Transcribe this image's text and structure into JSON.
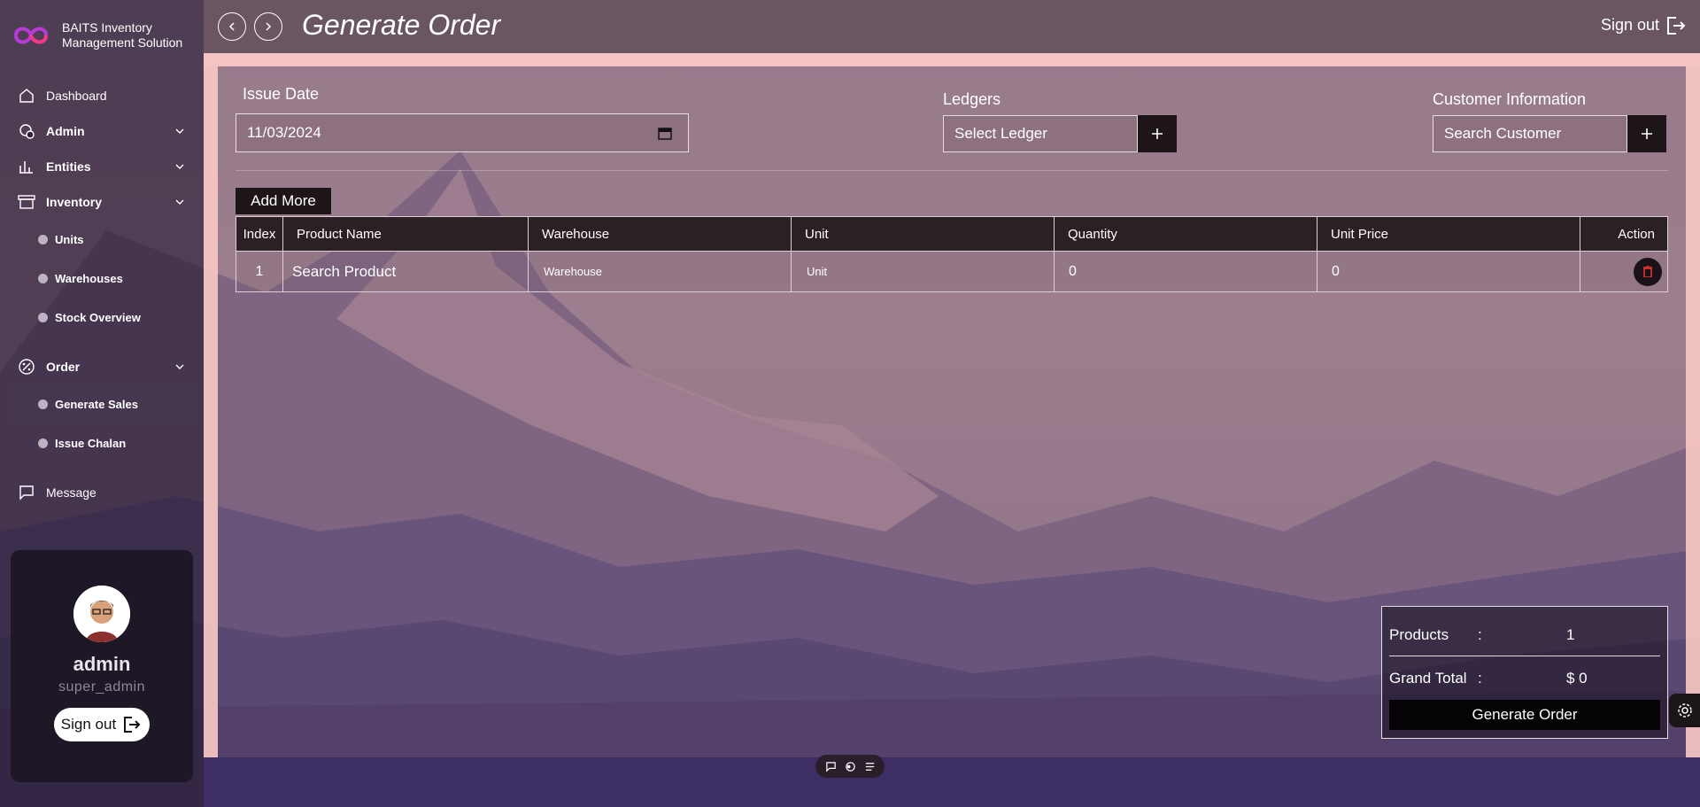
{
  "app": {
    "brand_line1": "BAITS Inventory",
    "brand_line2": "Management Solution"
  },
  "sidebar": {
    "items": [
      {
        "label": "Dashboard",
        "icon": "home-icon"
      },
      {
        "label": "Admin",
        "icon": "admin-gear-icon"
      },
      {
        "label": "Entities",
        "icon": "bar-chart-icon"
      },
      {
        "label": "Inventory",
        "icon": "archive-box-icon"
      },
      {
        "label": "Order",
        "icon": "percent-badge-icon"
      },
      {
        "label": "Message",
        "icon": "chat-bubble-icon"
      }
    ],
    "inventory_sub": [
      "Units",
      "Warehouses",
      "Stock Overview"
    ],
    "order_sub": [
      "Generate Sales",
      "Issue Chalan"
    ]
  },
  "profile": {
    "name": "admin",
    "role": "super_admin",
    "signout_label": "Sign out"
  },
  "header": {
    "title": "Generate Order",
    "signout_label": "Sign out"
  },
  "form": {
    "issue_date_label": "Issue Date",
    "issue_date_value": "11/03/2024",
    "ledgers_label": "Ledgers",
    "ledger_placeholder": "Select Ledger",
    "customer_label": "Customer Information",
    "customer_placeholder": "Search Customer",
    "add_more_label": "Add More"
  },
  "table": {
    "headers": [
      "Index",
      "Product Name",
      "Warehouse",
      "Unit",
      "Quantity",
      "Unit Price",
      "Action"
    ],
    "rows": [
      {
        "index": "1",
        "product": "Search Product",
        "warehouse": "Warehouse",
        "unit": "Unit",
        "quantity": "0",
        "unit_price": "0"
      }
    ]
  },
  "summary": {
    "products_label": "Products",
    "products_colon": ":",
    "products_value": "1",
    "total_label": "Grand Total",
    "total_colon": ":",
    "total_value": "$ 0",
    "button_label": "Generate Order"
  },
  "colors": {
    "accent_frame": "#f3c4c2",
    "dark_button": "#1d1518",
    "delete_icon": "#e0342f"
  }
}
